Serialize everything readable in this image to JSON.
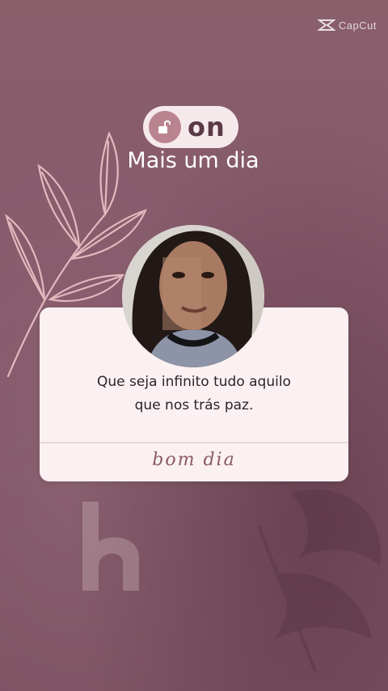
{
  "watermark": {
    "text": "CapCut",
    "icon": "capcut-logo-icon"
  },
  "status_pill": {
    "label": "on",
    "icon": "lock-icon"
  },
  "subtitle": "Mais um dia",
  "card": {
    "quote_line1": "Que seja infinito tudo aquilo",
    "quote_line2": "que nos trás paz.",
    "signature": "bom dia"
  },
  "colors": {
    "background": "#85596a",
    "card": "#fbf1f2",
    "pill": "#f6e9ec",
    "accent": "#b9838f"
  }
}
